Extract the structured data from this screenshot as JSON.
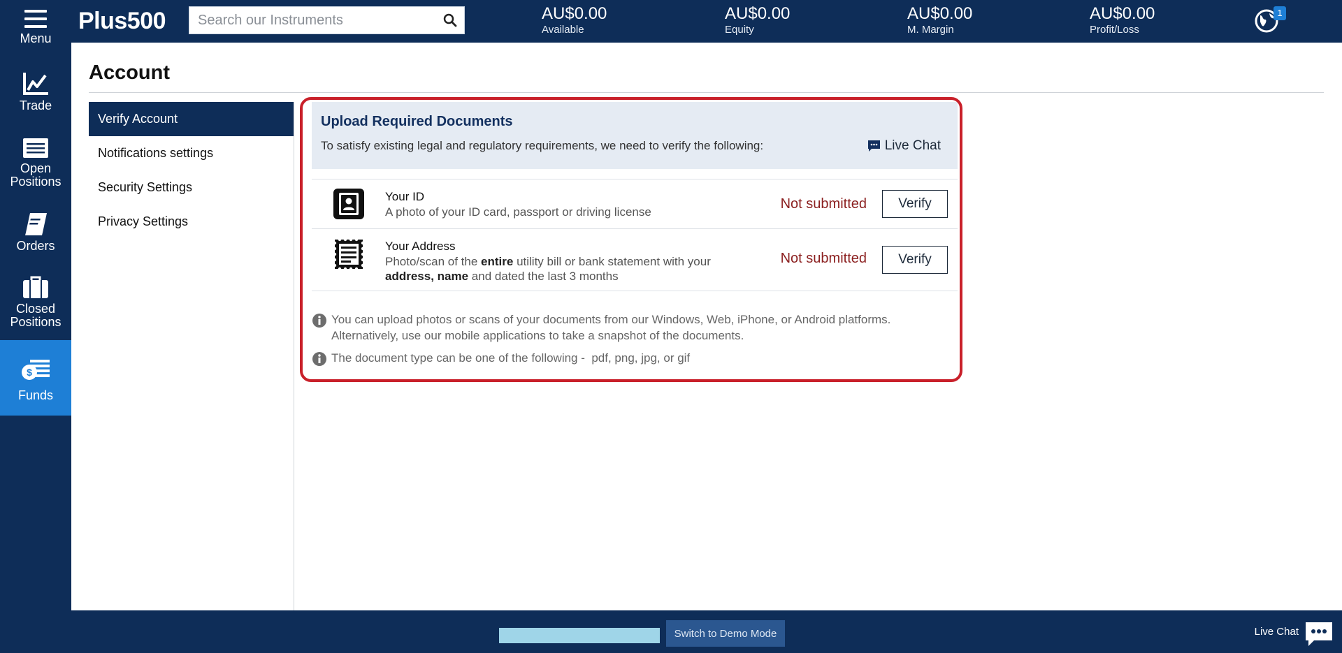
{
  "app": {
    "brand": "Plus500"
  },
  "search": {
    "placeholder": "Search our Instruments"
  },
  "stats": [
    {
      "value": "AU$0.00",
      "label": "Available"
    },
    {
      "value": "AU$0.00",
      "label": "Equity"
    },
    {
      "value": "AU$0.00",
      "label": "M. Margin"
    },
    {
      "value": "AU$0.00",
      "label": "Profit/Loss"
    }
  ],
  "notifications": {
    "count": "1"
  },
  "sidebar": {
    "items": [
      {
        "label": "Menu",
        "icon": "hamburger-icon"
      },
      {
        "label": "Trade",
        "icon": "chart-line-icon"
      },
      {
        "label": "Open Positions",
        "icon": "list-icon"
      },
      {
        "label": "Orders",
        "icon": "book-icon"
      },
      {
        "label": "Closed Positions",
        "icon": "briefcase-icon"
      },
      {
        "label": "Funds",
        "icon": "money-icon",
        "active": true
      }
    ]
  },
  "page": {
    "title": "Account"
  },
  "account_nav": {
    "items": [
      {
        "label": "Verify Account",
        "active": true
      },
      {
        "label": "Notifications settings"
      },
      {
        "label": "Security Settings"
      },
      {
        "label": "Privacy Settings"
      }
    ]
  },
  "upload": {
    "title": "Upload Required Documents",
    "subtitle": "To satisfy existing legal and regulatory requirements, we need to verify the following:",
    "live_chat": "Live Chat",
    "docs": [
      {
        "title": "Your ID",
        "desc": "A photo of your ID card, passport or driving license",
        "status": "Not submitted",
        "button": "Verify"
      },
      {
        "title": "Your Address",
        "desc_parts": [
          "Photo/scan of the ",
          "entire",
          " utility bill or bank statement with your ",
          "address, name",
          " and dated the last 3 months"
        ],
        "status": "Not submitted",
        "button": "Verify"
      }
    ],
    "info": [
      "You can upload photos or scans of your documents from our Windows, Web, iPhone, or Android platforms. Alternatively, use our mobile applications to take a snapshot of the documents.",
      "The document type can be one of the following -  pdf, png, jpg, or gif"
    ]
  },
  "footer": {
    "demo_button": "Switch to Demo Mode",
    "live_chat": "Live Chat"
  },
  "colors": {
    "navy": "#0e2d58",
    "active_blue": "#1e7fd6",
    "highlight_red": "#c9202a",
    "status_red": "#8b1f1f"
  }
}
